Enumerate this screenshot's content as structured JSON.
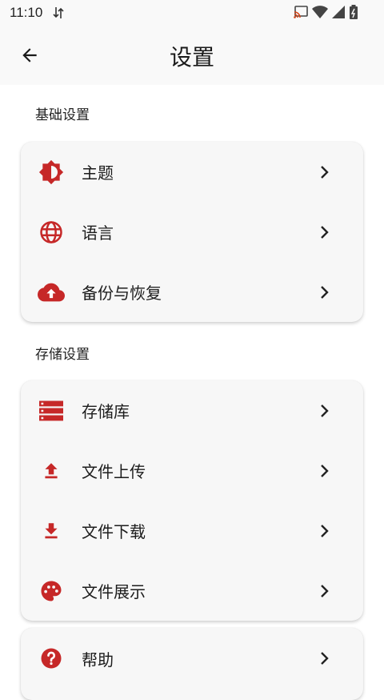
{
  "status_bar": {
    "time": "11:10"
  },
  "app_bar": {
    "title": "设置"
  },
  "sections": {
    "basic": {
      "label": "基础设置",
      "items": [
        {
          "label": "主题",
          "icon": "brightness-icon"
        },
        {
          "label": "语言",
          "icon": "globe-icon"
        },
        {
          "label": "备份与恢复",
          "icon": "cloud-upload-icon"
        }
      ]
    },
    "storage": {
      "label": "存储设置",
      "items": [
        {
          "label": "存储库",
          "icon": "storage-icon"
        },
        {
          "label": "文件上传",
          "icon": "upload-icon"
        },
        {
          "label": "文件下载",
          "icon": "download-icon"
        },
        {
          "label": "文件展示",
          "icon": "palette-icon"
        }
      ]
    },
    "other": {
      "items": [
        {
          "label": "帮助",
          "icon": "help-icon"
        }
      ]
    }
  },
  "colors": {
    "accent": "#c62828",
    "background": "#ffffff",
    "card": "#f7f7f7"
  }
}
